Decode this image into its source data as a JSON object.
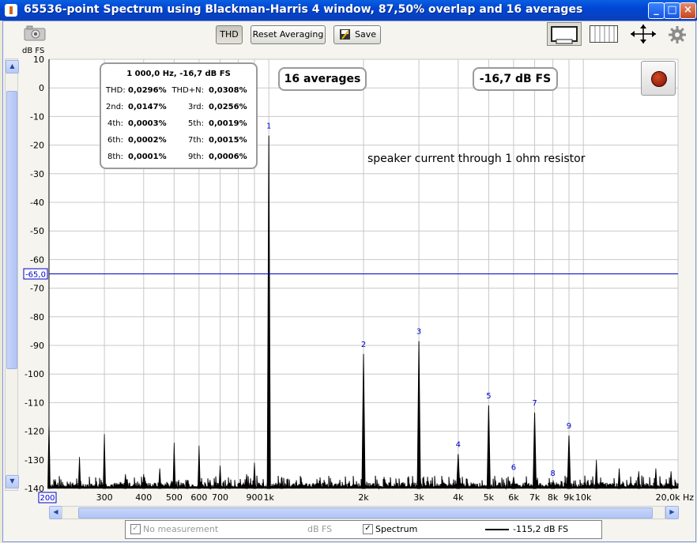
{
  "window": {
    "title": "65536-point Spectrum using Blackman-Harris 4 window, 87,50% overlap and 16 averages"
  },
  "toolbar": {
    "thd_label": "THD",
    "reset_label": "Reset Averaging",
    "save_label": "Save"
  },
  "icons": [
    "camera-icon",
    "save-icon",
    "single-view-icon",
    "grid-view-icon",
    "move-arrows-icon",
    "gear-icon",
    "record-icon"
  ],
  "colors": {
    "trace": "#000000",
    "grid": "#c8c8c8",
    "marker": "#0000cc",
    "labels": "#0000cc",
    "record": "#a01a00"
  },
  "thd_panel": {
    "header": "1 000,0 Hz, -16,7 dB FS",
    "rows": [
      {
        "l1": "THD:",
        "v1": "0,0296%",
        "l2": "THD+N:",
        "v2": "0,0308%"
      },
      {
        "l1": "2nd:",
        "v1": "0,0147%",
        "l2": "3rd:",
        "v2": "0,0256%"
      },
      {
        "l1": "4th:",
        "v1": "0,0003%",
        "l2": "5th:",
        "v2": "0,0019%"
      },
      {
        "l1": "6th:",
        "v1": "0,0002%",
        "l2": "7th:",
        "v2": "0,0015%"
      },
      {
        "l1": "8th:",
        "v1": "0,0001%",
        "l2": "9th:",
        "v2": "0,0006%"
      }
    ]
  },
  "averages_badge": "16 averages",
  "level_badge": "-16,7 dB FS",
  "marker_label": "-65,0",
  "x_start_label": "200",
  "legend": {
    "no_measurement": "No measurement",
    "unit": "dB FS",
    "spectrum": "Spectrum",
    "spectrum_value": "-115,2 dB FS"
  },
  "chart_data": {
    "type": "line",
    "ylabel": "dB FS",
    "xlabel": "",
    "x_scale": "log",
    "xlim": [
      200,
      20000
    ],
    "ylim": [
      -140,
      10
    ],
    "grid": true,
    "annotation": "speaker current through 1 ohm resistor",
    "x_ticks": [
      {
        "v": 300,
        "label": "300"
      },
      {
        "v": 400,
        "label": "400"
      },
      {
        "v": 500,
        "label": "500"
      },
      {
        "v": 600,
        "label": "600"
      },
      {
        "v": 700,
        "label": "700"
      },
      {
        "v": 900,
        "label": "900"
      },
      {
        "v": 1000,
        "label": "1k"
      },
      {
        "v": 2000,
        "label": "2k"
      },
      {
        "v": 3000,
        "label": "3k"
      },
      {
        "v": 4000,
        "label": "4k"
      },
      {
        "v": 5000,
        "label": "5k"
      },
      {
        "v": 6000,
        "label": "6k"
      },
      {
        "v": 7000,
        "label": "7k"
      },
      {
        "v": 8000,
        "label": "8k"
      },
      {
        "v": 9000,
        "label": "9k"
      },
      {
        "v": 10000,
        "label": "10k"
      },
      {
        "v": 20000,
        "label": "20,0k Hz"
      }
    ],
    "y_ticks": [
      10,
      0,
      -10,
      -20,
      -30,
      -40,
      -50,
      -60,
      -70,
      -80,
      -90,
      -100,
      -110,
      -120,
      -130,
      -140
    ],
    "marker_level": -65,
    "harmonics": [
      {
        "label": "1",
        "freq": 1000,
        "db": -16.7
      },
      {
        "label": "2",
        "freq": 2000,
        "db": -93
      },
      {
        "label": "3",
        "freq": 3000,
        "db": -88.5
      },
      {
        "label": "4",
        "freq": 4000,
        "db": -128
      },
      {
        "label": "5",
        "freq": 5000,
        "db": -111
      },
      {
        "label": "6",
        "freq": 6000,
        "db": -136
      },
      {
        "label": "7",
        "freq": 7000,
        "db": -113.5
      },
      {
        "label": "8",
        "freq": 8000,
        "db": -138
      },
      {
        "label": "9",
        "freq": 9000,
        "db": -121.5
      }
    ],
    "spurs": [
      {
        "freq": 200,
        "db": -116
      },
      {
        "freq": 250,
        "db": -129
      },
      {
        "freq": 300,
        "db": -121
      },
      {
        "freq": 350,
        "db": -135
      },
      {
        "freq": 400,
        "db": -135
      },
      {
        "freq": 450,
        "db": -133
      },
      {
        "freq": 500,
        "db": -124
      },
      {
        "freq": 550,
        "db": -137
      },
      {
        "freq": 600,
        "db": -125
      },
      {
        "freq": 650,
        "db": -137
      },
      {
        "freq": 700,
        "db": -132
      },
      {
        "freq": 750,
        "db": -138
      },
      {
        "freq": 850,
        "db": -135
      },
      {
        "freq": 900,
        "db": -131
      },
      {
        "freq": 1100,
        "db": -136
      },
      {
        "freq": 11000,
        "db": -130
      },
      {
        "freq": 13000,
        "db": -133
      },
      {
        "freq": 15000,
        "db": -134
      },
      {
        "freq": 17000,
        "db": -133
      },
      {
        "freq": 19000,
        "db": -134
      }
    ],
    "noise_floor": [
      -139.5,
      -135.5
    ]
  }
}
